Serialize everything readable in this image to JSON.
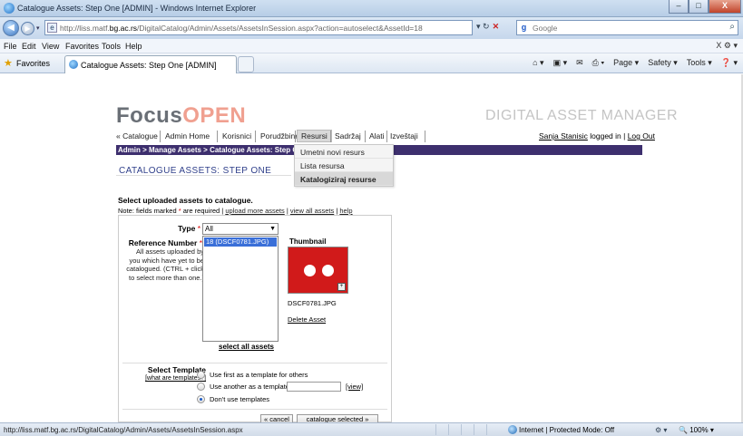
{
  "window": {
    "title": "Catalogue Assets: Step One [ADMIN] - Windows Internet Explorer",
    "buttons": [
      "–",
      "□",
      "X"
    ]
  },
  "address": {
    "url_prefix": "http://liss.matf.",
    "url_domain": "bg.ac.rs",
    "url_rest": "/DigitalCatalog/Admin/Assets/AssetsInSession.aspx?action=autoselect&AssetId=18",
    "search_placeholder": "Google"
  },
  "menu": {
    "items": [
      "File",
      "Edit",
      "View",
      "Favorites",
      "Tools",
      "Help"
    ],
    "right": "X  ⚙ ▾"
  },
  "favbar": {
    "label": "Favorites",
    "tab_title": "Catalogue Assets: Step One [ADMIN]",
    "commands": [
      "Page ▾",
      "Safety ▾",
      "Tools ▾",
      "❓ ▾"
    ]
  },
  "header": {
    "logo_part1": "Focus",
    "logo_part2": "OPEN",
    "tagline": "DIGITAL ASSET MANAGER",
    "login_user": "Sanja Stanisic",
    "login_middle": "logged in |",
    "logout": "Log Out"
  },
  "nav": {
    "items": [
      "« Catalogue",
      "Admin Home",
      "Korisnici",
      "Porudžbine",
      "Resursi",
      "Sadržaj",
      "Alati",
      "Izveštaji"
    ]
  },
  "breadcrumb": "Admin > Manage Assets > Catalogue Assets: Step One",
  "dropdown": {
    "items": [
      "Umetni novi resurs",
      "Lista resursa",
      "Katalogiziraj resurse"
    ]
  },
  "page": {
    "heading": "CATALOGUE ASSETS: STEP ONE",
    "intro": "Select uploaded assets to catalogue.",
    "note_text": "Note: fields marked",
    "note_star": "*",
    "note_required": "are required |",
    "note_link1": "upload more assets",
    "note_link2": "view all assets",
    "note_link3": "help"
  },
  "form": {
    "type_label": "Type",
    "type_value": "All",
    "refnum_label": "Reference Number",
    "refnum_help": "All assets uploaded by you which have yet to be catalogued. (CTRL + click to select more than one.)",
    "list_items": [
      "18 (DSCF0781.JPG)"
    ],
    "thumbnail_label": "Thumbnail",
    "filename": "DSCF0781.JPG",
    "delete": "Delete Asset",
    "select_all": "select all assets",
    "template_label": "Select Template",
    "template_help": "[what are templates?]",
    "radio1": "Use first as a template for others",
    "radio2": "Use another as a template:",
    "radio3": "Don't use templates",
    "view": "[view]",
    "cancel": "« cancel",
    "submit": "catalogue selected »"
  },
  "status": {
    "url": "http://liss.matf.bg.ac.rs/DigitalCatalog/Admin/Assets/AssetsInSession.aspx",
    "zone": "Internet | Protected Mode: Off",
    "zoom": "100%"
  }
}
